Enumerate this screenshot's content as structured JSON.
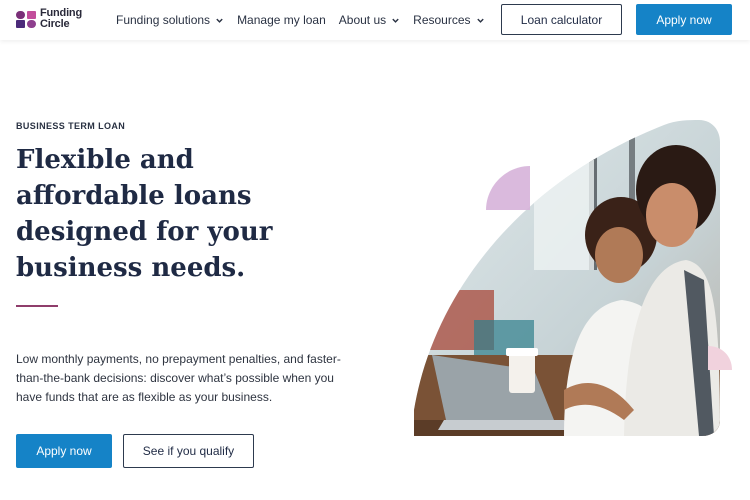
{
  "brand": {
    "line1": "Funding",
    "line2": "Circle",
    "colors": {
      "purple": "#6b2a6b",
      "accent_blue": "#1583c7",
      "divider": "#8f3d6b"
    }
  },
  "nav": {
    "items": [
      {
        "label": "Funding solutions",
        "has_dropdown": true
      },
      {
        "label": "Manage my loan",
        "has_dropdown": false
      },
      {
        "label": "About us",
        "has_dropdown": true
      },
      {
        "label": "Resources",
        "has_dropdown": true
      }
    ],
    "calculator_label": "Loan calculator",
    "apply_label": "Apply now"
  },
  "hero": {
    "eyebrow": "BUSINESS TERM LOAN",
    "headline": "Flexible and affordable loans designed for your business needs.",
    "body": "Low monthly payments, no prepayment penalties, and faster-than-the-bank decisions: discover what’s possible when you have funds that are as flexible as your business.",
    "primary_cta": "Apply now",
    "secondary_cta": "See if you qualify",
    "image_icon": "two-women-at-laptop-photo"
  }
}
